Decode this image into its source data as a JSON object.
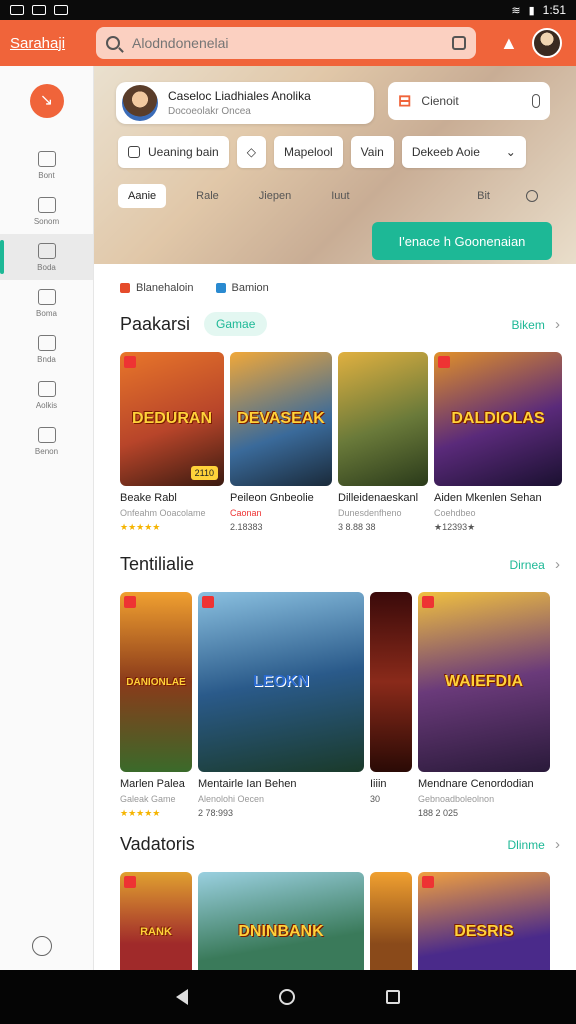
{
  "status": {
    "time": "1:51"
  },
  "topbar": {
    "brand": "Sarahaji",
    "search_placeholder": "Alodndonenelai"
  },
  "sidebar": {
    "items": [
      {
        "label": "Bont"
      },
      {
        "label": "Sonom"
      },
      {
        "label": "Boda"
      },
      {
        "label": "Boma"
      },
      {
        "label": "Bnda"
      },
      {
        "label": "Aolkis"
      },
      {
        "label": "Benon"
      }
    ]
  },
  "hero": {
    "profile_name": "Caseloc Liadhiales Anolika",
    "profile_sub": "Docoeolakr Oncea",
    "voice_label": "Cienoit",
    "chips": [
      "Ueaning bain",
      "Mapelool",
      "Vain"
    ],
    "dropdown": "Dekeeb Aoie",
    "filters": [
      "Aanie",
      "Rale",
      "Jiepen",
      "Iuut"
    ],
    "filter_last": "Bit",
    "cta": "I'enace h Goonenaian"
  },
  "tags": [
    "Blanehaloin",
    "Bamion"
  ],
  "sections": [
    {
      "title": "Paakarsi",
      "pill": "Gamae",
      "more": "Bikem",
      "cards": [
        {
          "cover": "DEDURAN",
          "title": "Beake Rabl",
          "sub": "Onfeahm Ooacolame",
          "meta": "★★★★★",
          "age": "2110",
          "color": "#b8452a"
        },
        {
          "cover": "DEVASEAK",
          "title": "Peileon Gnbeolie",
          "sub": "Caonan",
          "meta": "2.18383",
          "color": "#3a6a9a"
        },
        {
          "cover": "",
          "title": "Dilleidenaeskanl",
          "sub": "Dunesdenfheno",
          "meta": "3 8.88 38",
          "color": "#6a7a3a"
        },
        {
          "cover": "DALDIOLAS",
          "title": "Aiden Mkenlen Sehan",
          "sub": "Coehdbeo",
          "meta": "★12393★",
          "color": "#5a2a7a"
        }
      ]
    },
    {
      "title": "Tentilialie",
      "pill": "",
      "more": "Dirnea",
      "cards": [
        {
          "cover": "DANIONLAE",
          "title": "Marlen Palea",
          "sub": "Galeak Game",
          "meta": "★★★★★",
          "color": "#8a3a1a"
        },
        {
          "cover": "LEOKN",
          "title": "Mentairle Ian Behen",
          "sub": "Alenolohi Oecen",
          "meta": "2 78:993",
          "color": "#2a5a8a"
        },
        {
          "cover": "",
          "title": "Iiiin",
          "sub": "",
          "meta": "30",
          "color": "#5a1a10"
        },
        {
          "cover": "WAIEFDIA",
          "title": "Mendnare Cenordodian",
          "sub": "Gebnoadboleolnon",
          "meta": "188 2 025",
          "color": "#6a3a7a"
        }
      ]
    },
    {
      "title": "Vadatoris",
      "pill": "",
      "more": "Dlinme",
      "cards": [
        {
          "cover": "RANK",
          "title": "",
          "sub": "",
          "meta": "",
          "color": "#a02a2a"
        },
        {
          "cover": "DNINBANK",
          "title": "",
          "sub": "",
          "meta": "",
          "color": "#3a7a5a"
        },
        {
          "cover": "",
          "title": "",
          "sub": "",
          "meta": "",
          "color": "#8a4a1a"
        },
        {
          "cover": "DESRIS",
          "title": "",
          "sub": "",
          "meta": "",
          "color": "#4a2a8a"
        }
      ]
    }
  ]
}
